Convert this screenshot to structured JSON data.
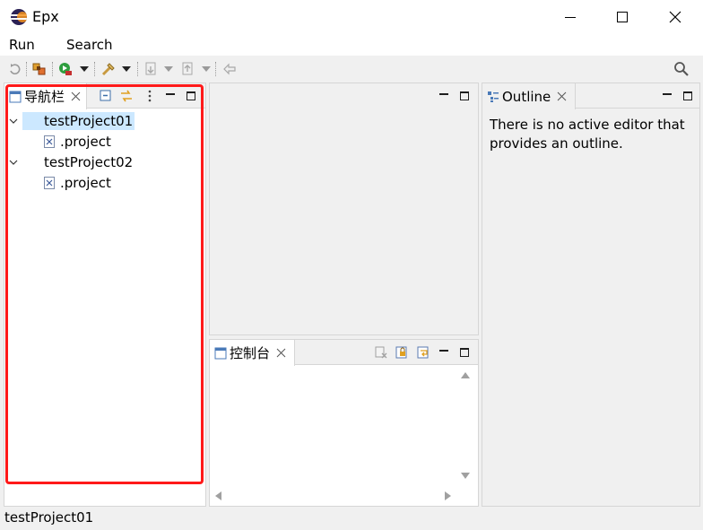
{
  "window": {
    "title": "Epx",
    "icons": {
      "app": "eclipse-logo-icon",
      "minimize": "minimize-icon",
      "maximize": "maximize-icon",
      "close": "close-icon"
    }
  },
  "menu": {
    "items": [
      "Run",
      "Search"
    ]
  },
  "toolbar": {
    "icons": [
      "refresh-icon",
      "build-icon",
      "run-icon",
      "run-dropdown-icon",
      "external-tools-icon",
      "external-tools-dropdown-icon",
      "next-annotation-icon",
      "next-dropdown-icon",
      "previous-annotation-icon",
      "previous-dropdown-icon",
      "back-icon",
      "search-icon"
    ]
  },
  "navigator": {
    "tab_label": "导航栏",
    "tree": [
      {
        "label": "testProject01",
        "expanded": true,
        "selected": true,
        "children": [
          {
            "label": ".project"
          }
        ]
      },
      {
        "label": "testProject02",
        "expanded": true,
        "selected": false,
        "children": [
          {
            "label": ".project"
          }
        ]
      }
    ]
  },
  "console": {
    "tab_label": "控制台"
  },
  "outline": {
    "tab_label": "Outline",
    "message": "There is no active editor that provides an outline."
  },
  "status": {
    "text": "testProject01"
  },
  "colors": {
    "selection": "#cce8ff",
    "highlight_border": "#ff1a1a",
    "panel_background": "#ffffff",
    "chrome_background": "#f0f0f0"
  }
}
